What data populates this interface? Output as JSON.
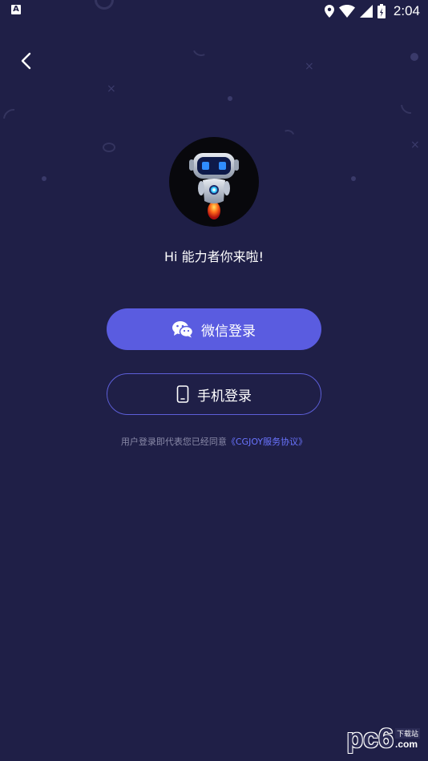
{
  "status_bar": {
    "left_icon_label": "A",
    "time": "2:04",
    "icons": [
      "location-icon",
      "wifi-icon",
      "signal-icon",
      "battery-icon"
    ]
  },
  "header": {
    "back_icon": "chevron-left-icon"
  },
  "avatar": {
    "icon": "robot-mascot"
  },
  "greeting": "Hi 能力者你来啦!",
  "buttons": {
    "wechat_label": "微信登录",
    "wechat_icon": "wechat-icon",
    "phone_label": "手机登录",
    "phone_icon": "smartphone-icon"
  },
  "agreement": {
    "prefix": "用户登录即代表您已经同意",
    "link": "《CGJOY服务协议》"
  },
  "watermark": {
    "main": "pc6",
    "top": "下载站",
    "suffix": ".com"
  },
  "colors": {
    "background": "#1f1f47",
    "primary_button": "#5a5ce0",
    "outline_button": "#5d5fd8",
    "link": "#6a74ff"
  }
}
